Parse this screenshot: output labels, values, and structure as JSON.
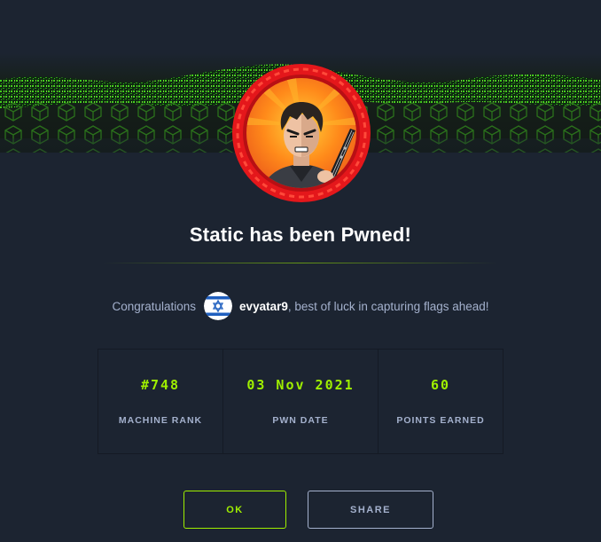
{
  "title": "Static has been Pwned!",
  "congrats": {
    "prefix": "Congratulations",
    "username": "evyatar9",
    "suffix": ", best of luck in capturing flags ahead!"
  },
  "stats": [
    {
      "value": "#748",
      "label": "MACHINE RANK"
    },
    {
      "value": "03 Nov 2021",
      "label": "PWN DATE"
    },
    {
      "value": "60",
      "label": "POINTS EARNED"
    }
  ],
  "buttons": {
    "ok": "OK",
    "share": "SHARE"
  },
  "colors": {
    "background": "#1c2431",
    "accent": "#9fef00",
    "muted": "#a4b1cd",
    "avatar_ring": "#e4171b"
  },
  "icons": {
    "flag": "israel-flag-icon",
    "avatar": "machine-avatar-icon"
  }
}
